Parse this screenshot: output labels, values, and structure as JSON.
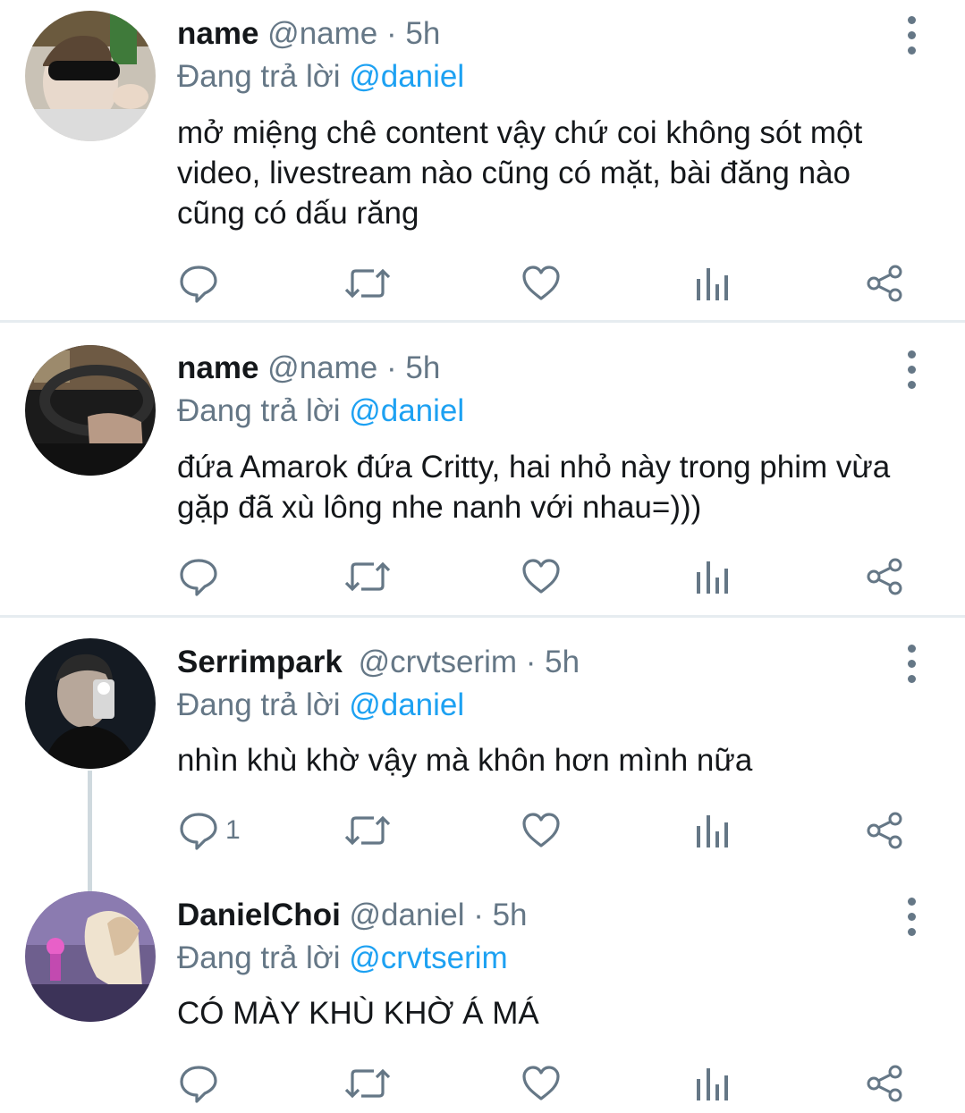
{
  "reply_prefix": "Đang trả lời",
  "tweets": [
    {
      "name": "name",
      "meta": "@name · 5h",
      "reply_to": "@daniel",
      "text": "mở miệng chê content vậy chứ coi không sót một video, livestream nào cũng có mặt, bài đăng nào cũng có dấu răng",
      "reply_count": ""
    },
    {
      "name": "name",
      "meta": "@name · 5h",
      "reply_to": "@daniel",
      "text": "đứa Amarok đứa Critty, hai nhỏ này trong phim vừa gặp đã xù lông nhe nanh với nhau=)))",
      "reply_count": ""
    },
    {
      "name": "Serrimpark",
      "meta": "@crvtserim · 5h",
      "reply_to": "@daniel",
      "text": "nhìn khù khờ vậy mà khôn hơn mình nữa",
      "reply_count": "1"
    },
    {
      "name": "DanielChoi",
      "meta": "@daniel · 5h",
      "reply_to": "@crvtserim",
      "text": "CÓ MÀY KHÙ KHỜ Á MÁ",
      "reply_count": ""
    }
  ],
  "colors": {
    "accent": "#1da1f2",
    "secondary_text": "#657786",
    "primary_text": "#14171a",
    "separator": "#e6ecf0",
    "icon": "#657786"
  },
  "icons": [
    "reply-icon",
    "retweet-icon",
    "like-icon",
    "analytics-icon",
    "share-icon",
    "more-options-icon"
  ]
}
